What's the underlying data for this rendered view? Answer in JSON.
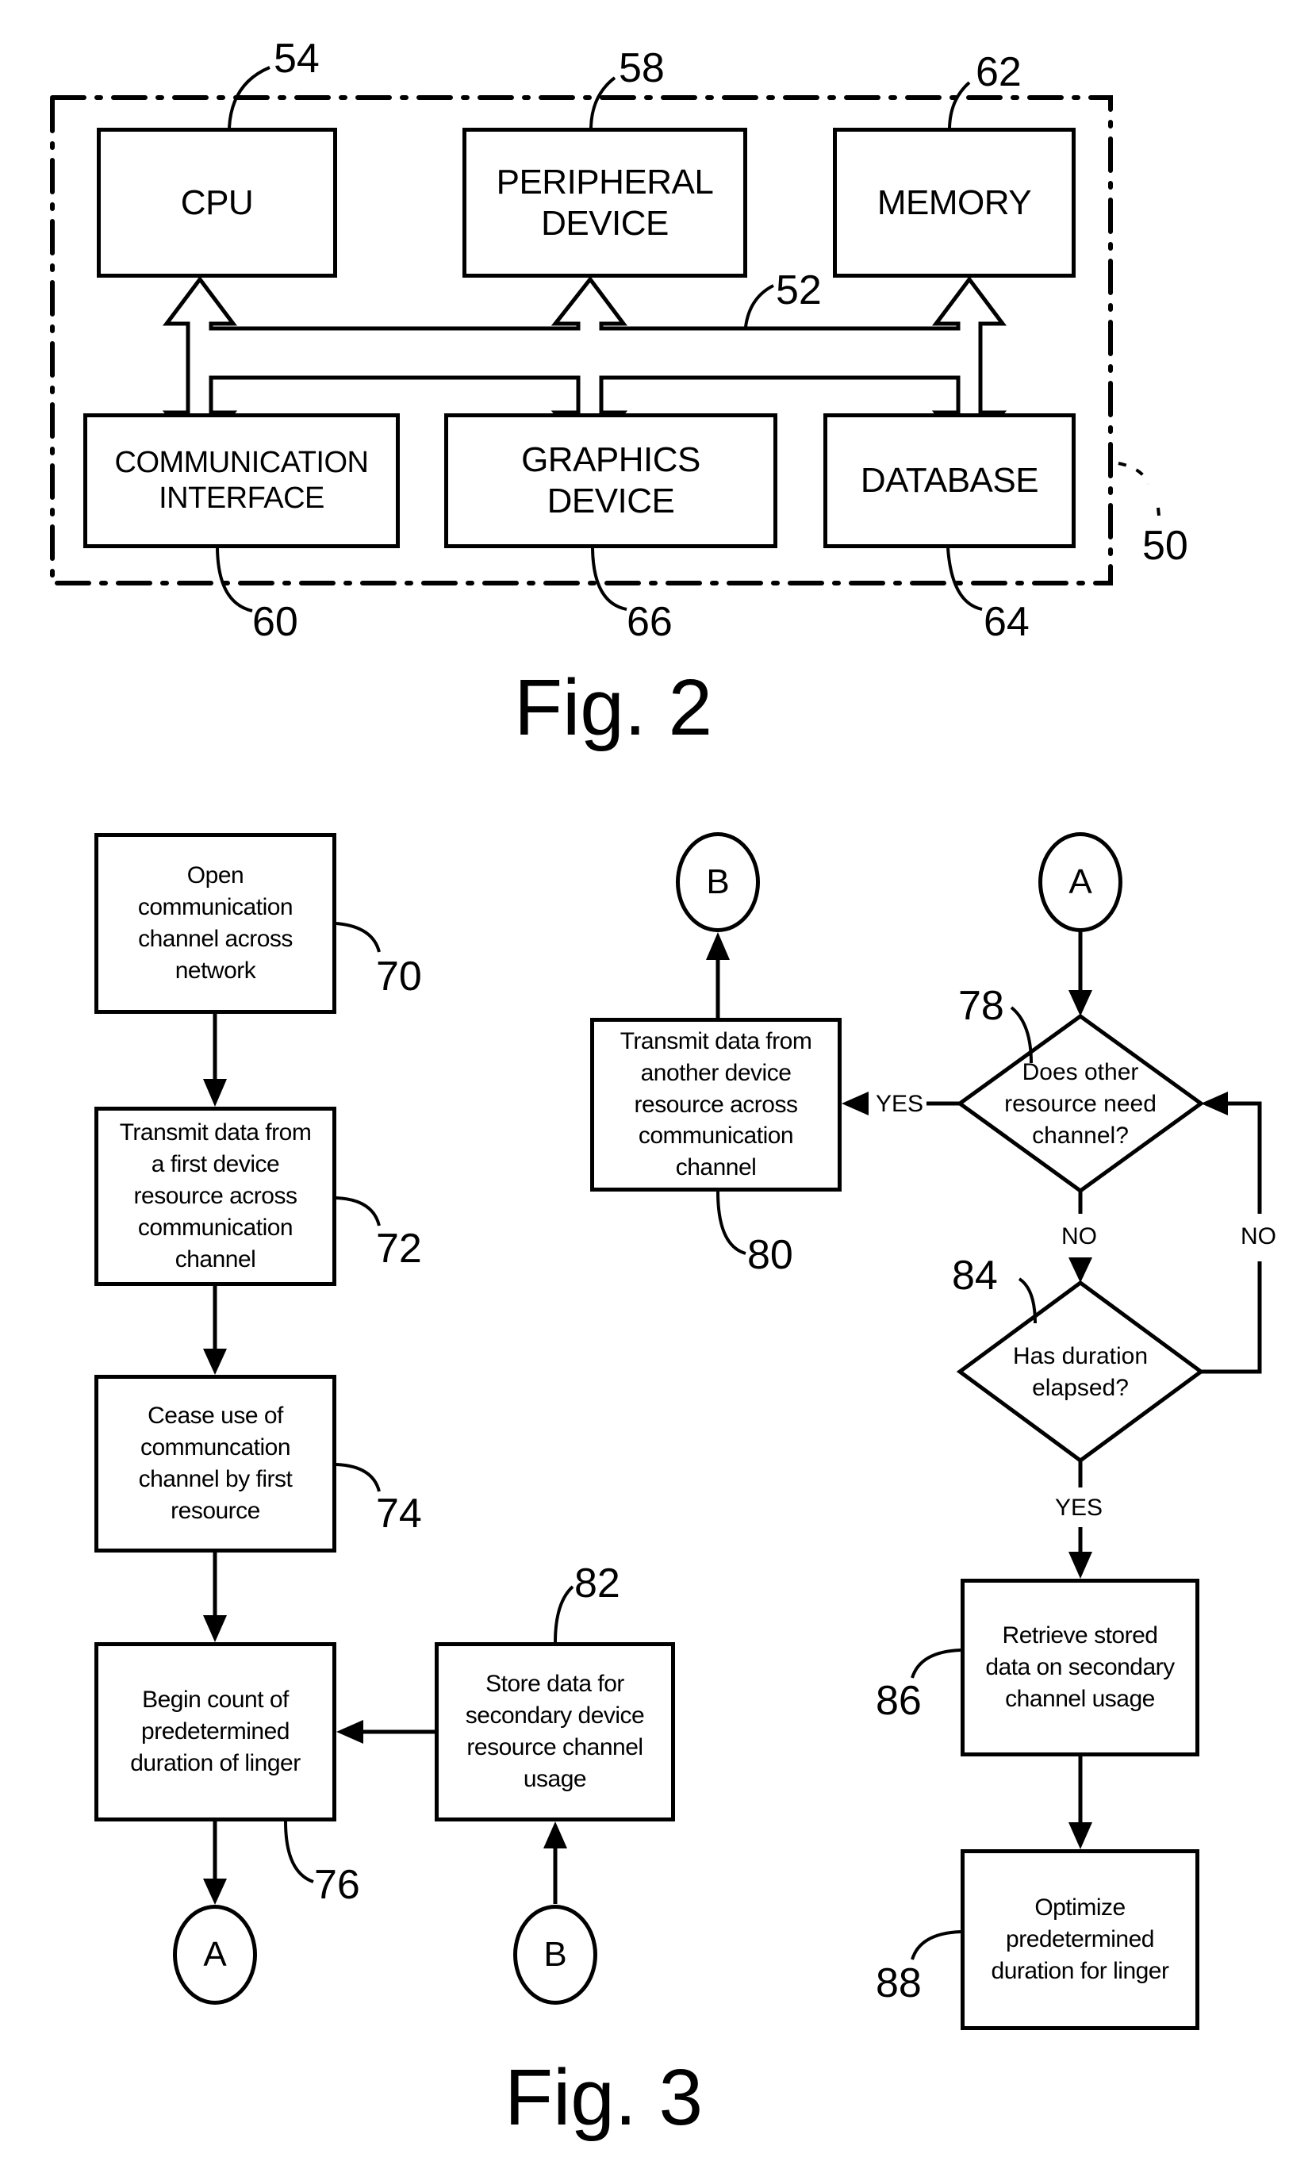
{
  "fig2": {
    "caption": "Fig. 2",
    "system_ref": "50",
    "bus_ref": "52",
    "blocks": {
      "cpu": {
        "label": "CPU",
        "ref": "54"
      },
      "peripheral": {
        "label": "PERIPHERAL\nDEVICE",
        "ref": "58"
      },
      "memory": {
        "label": "MEMORY",
        "ref": "62"
      },
      "comm": {
        "label": "COMMUNICATION\nINTERFACE",
        "ref": "60"
      },
      "graphics": {
        "label": "GRAPHICS\nDEVICE",
        "ref": "66"
      },
      "database": {
        "label": "DATABASE",
        "ref": "64"
      }
    }
  },
  "fig3": {
    "caption": "Fig. 3",
    "steps": {
      "s70": {
        "label": "Open\ncommunication\nchannel across\nnetwork",
        "ref": "70"
      },
      "s72": {
        "label": "Transmit data from\na first device\nresource across\ncommunication\nchannel",
        "ref": "72"
      },
      "s74": {
        "label": "Cease use of\ncommuncation\nchannel by first\nresource",
        "ref": "74"
      },
      "s76": {
        "label": "Begin count of\npredetermined\nduration of linger",
        "ref": "76"
      },
      "s82": {
        "label": "Store data for\nsecondary device\nresource channel\nusage",
        "ref": "82"
      },
      "s80": {
        "label": "Transmit data from\nanother device\nresource across\ncommunication\nchannel",
        "ref": "80"
      },
      "s86": {
        "label": "Retrieve stored\ndata on secondary\nchannel usage",
        "ref": "86"
      },
      "s88": {
        "label": "Optimize\npredetermined\nduration for linger",
        "ref": "88"
      }
    },
    "decisions": {
      "d78": {
        "label": "Does other\nresource need\nchannel?",
        "ref": "78"
      },
      "d84": {
        "label": "Has duration\nelapsed?",
        "ref": "84"
      }
    },
    "connectors": {
      "a_out": "A",
      "b_in": "B",
      "b_out": "B",
      "a_in": "A"
    },
    "branch_labels": {
      "d78_yes": "YES",
      "d78_no": "NO",
      "d84_no": "NO",
      "d84_yes": "YES"
    }
  }
}
